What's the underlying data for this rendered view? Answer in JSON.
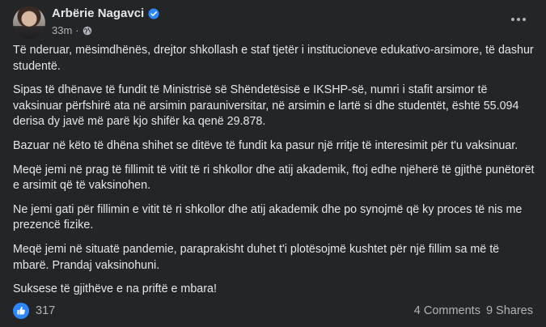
{
  "post": {
    "author": "Arbërie Nagavci",
    "time": "33m",
    "separator": "·",
    "paragraphs": [
      "Të nderuar, mësimdhënës, drejtor shkollash e staf tjetër i institucioneve edukativo-arsimore, të dashur studentë.",
      "Sipas të dhënave të fundit të Ministrisë së Shëndetësisë e IKSHP-së, numri i stafit arsimor të vaksinuar përfshirë ata në arsimin parauniversitar, në arsimin e lartë si dhe studentët, është 55.094 derisa dy javë më parë kjo shifër ka qenë 29.878.",
      "Bazuar në këto të dhëna shihet se ditëve të fundit ka pasur një rritje të interesimit për t'u vaksinuar.",
      "Meqë jemi në prag të fillimit të vitit të ri shkollor dhe atij akademik, ftoj edhe njëherë të gjithë punëtorët e arsimit që të vaksinohen.",
      "Ne jemi gati për fillimin e vitit të ri shkollor dhe atij akademik dhe po synojmë që ky proces të nis me prezencë fizike.",
      "Meqë jemi në situatë pandemie, paraprakisht duhet t'i plotësojmë kushtet për një fillim sa më të mbarë. Prandaj vaksinohuni.",
      "Suksese të gjithëve e na priftë e mbara!"
    ]
  },
  "footer": {
    "reaction_count": "317",
    "comments": "4 Comments",
    "shares": "9 Shares"
  },
  "icons": {
    "verified": "verified-badge-icon",
    "privacy": "globe-icon",
    "like": "like-icon",
    "more": "more-options-icon"
  },
  "colors": {
    "background": "#242526",
    "text_primary": "#e4e6eb",
    "text_secondary": "#b0b3b8",
    "accent_blue": "#2d88ff"
  }
}
